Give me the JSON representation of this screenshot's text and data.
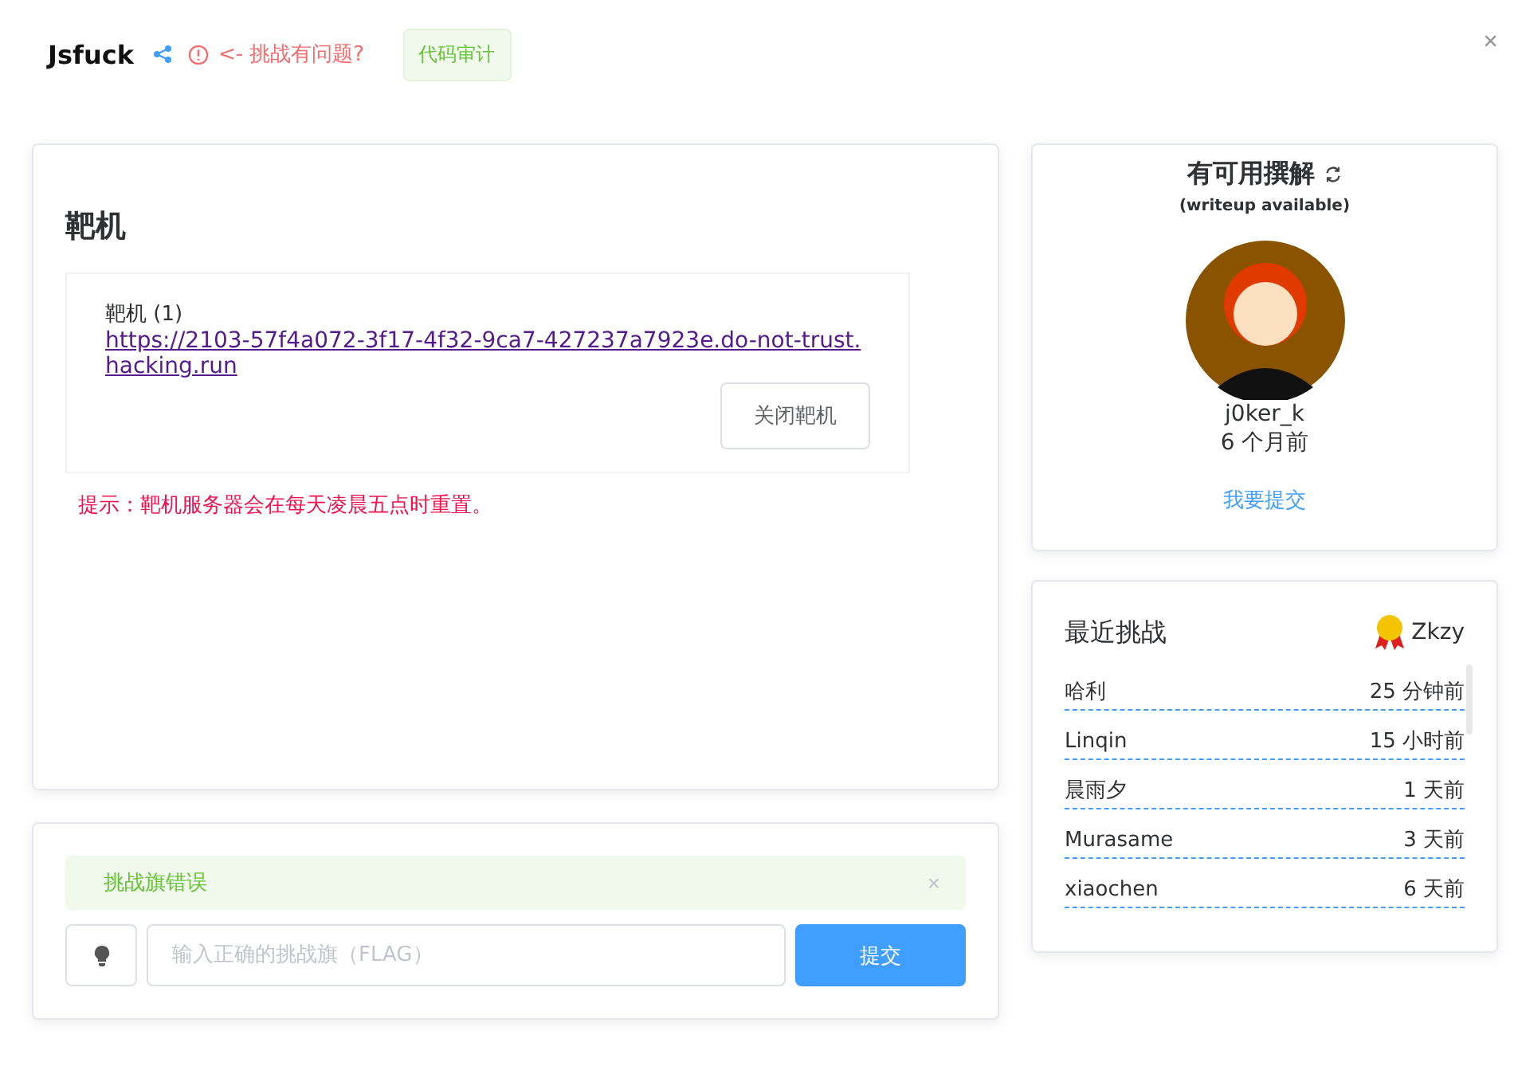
{
  "header": {
    "title": "Jsfuck",
    "report_link": "<- 挑战有问题?",
    "tag": "代码审计",
    "close": "×"
  },
  "target": {
    "heading": "靶机",
    "label": "靶机 (1)",
    "url": "https://2103-57f4a072-3f17-4f32-9ca7-427237a7923e.do-not-trust.hacking.run",
    "close_button": "关闭靶机",
    "hint": "提示：靶机服务器会在每天凌晨五点时重置。"
  },
  "writeup": {
    "title": "有可用撰解",
    "subtitle": "(writeup available)",
    "author": "j0ker_k",
    "time": "6 个月前",
    "submit_link": "我要提交"
  },
  "recent": {
    "title": "最近挑战",
    "top_user": "Zkzy",
    "rows": [
      {
        "name": "哈利",
        "time": "25 分钟前"
      },
      {
        "name": "Linqin",
        "time": "15 小时前"
      },
      {
        "name": "晨雨夕",
        "time": "1 天前"
      },
      {
        "name": "Murasame",
        "time": "3 天前"
      },
      {
        "name": "xiaochen",
        "time": "6 天前"
      }
    ]
  },
  "flag": {
    "alert": "挑战旗错误",
    "alert_close": "×",
    "placeholder": "输入正确的挑战旗（FLAG）",
    "submit": "提交"
  }
}
